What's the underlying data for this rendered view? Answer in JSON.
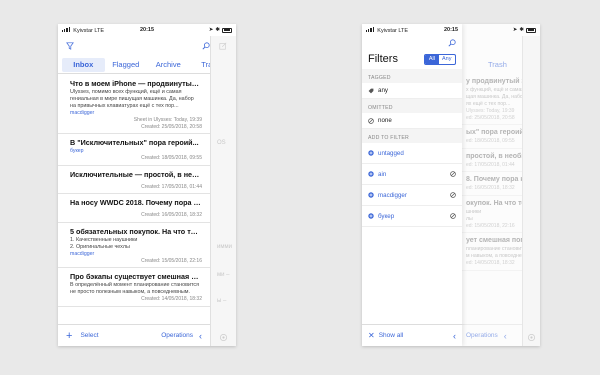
{
  "status": {
    "carrier": "Kyivstar",
    "network": "LTE",
    "time": "20:15"
  },
  "left": {
    "tabs": [
      "Inbox",
      "Flagged",
      "Archive",
      "Trash"
    ],
    "items": [
      {
        "title": "Что в моем iPhone — продвинутый за...",
        "body": [
          "Ulysses, помимо всех функций, ещё и самая",
          "гениальная в мире пишущая машинка. Да, набор",
          "на привычных клавиатурах ещё с тех пор..."
        ],
        "tag": "macdigger",
        "meta": [
          "Sheet in Ulysses: Today, 19:39",
          "Created: 25/05/2018, 20:58"
        ]
      },
      {
        "title": "В \"Исключительных\" пора героий...",
        "body": [],
        "tag": "букер",
        "meta": [
          "Created: 18/05/2018, 09:55"
        ]
      },
      {
        "title": "Исключительные — простой, в необи...",
        "body": [],
        "tag": "",
        "meta": [
          "Created: 17/05/2018, 01:44"
        ]
      },
      {
        "title": "На носу WWDC 2018. Почему пора ко...",
        "body": [],
        "tag": "",
        "meta": [
          "Created: 16/05/2018, 18:32"
        ]
      },
      {
        "title": "5 обязательных покупок. На что точн...",
        "body": [
          "1. Качественные наушники",
          "2. Оригинальные чехлы"
        ],
        "tag": "macdigger",
        "meta": [
          "Created: 15/05/2018, 22:16"
        ]
      },
      {
        "title": "Про бэкапы существует смешная пог...",
        "body": [
          "В определённый момент планирование становится",
          "не просто полезным навыком, а повседневным."
        ],
        "tag": "",
        "meta": [
          "Created: 14/05/2018, 18:32"
        ]
      }
    ],
    "toolbar": {
      "select": "Select",
      "operations": "Operations"
    },
    "peek": [
      "ОS",
      "имми",
      "ми –",
      "ы –"
    ]
  },
  "right": {
    "title": "Filters",
    "seg": {
      "all": "All",
      "any": "Any"
    },
    "tagged_label": "TAGGED",
    "tagged_item": "any",
    "omitted_label": "OMITTED",
    "omitted_item": "none",
    "add_label": "ADD TO FILTER",
    "add_items": [
      "untagged",
      "ain",
      "macdigger",
      "букер"
    ],
    "show_all": "Show all",
    "behind_tab": "Trash",
    "behind_operations": "Operations",
    "behind_items": [
      {
        "title": "у продвинутый за...",
        "body": [
          "х функций, ещё и самая",
          "щая машинка. Да, набор",
          "ях ещё с тех пор..."
        ],
        "meta": [
          "Ulysses: Today, 19:39",
          "ed: 25/05/2018, 20:58"
        ]
      },
      {
        "title": "ых\" пора героий...",
        "body": [],
        "meta": [
          "ed: 18/05/2018, 09:55"
        ]
      },
      {
        "title": "простой, в необи...",
        "body": [],
        "meta": [
          "ed: 17/05/2018, 01:44"
        ]
      },
      {
        "title": "8. Почему пора ко...",
        "body": [],
        "meta": [
          "ed: 16/05/2018, 18:32"
        ]
      },
      {
        "title": "окупок. На что точн...",
        "body": [
          "шники",
          "лы"
        ],
        "meta": [
          "ed: 15/05/2018, 22:16"
        ]
      },
      {
        "title": "ует смешная пог...",
        "body": [
          "планирование становится",
          "м навыком, а повседневным."
        ],
        "meta": [
          "ed: 14/05/2018, 18:32"
        ]
      }
    ]
  },
  "colors": {
    "accent": "#3b66d8",
    "background": "#e9e9e9"
  }
}
